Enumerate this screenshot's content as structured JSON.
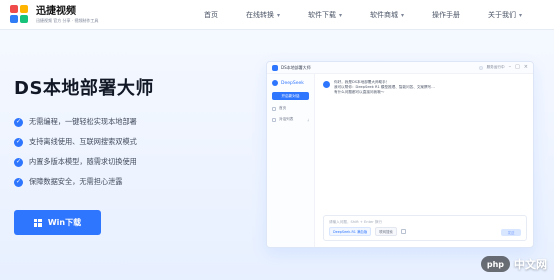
{
  "brand": {
    "title": "迅捷视频",
    "subtitle": "迅捷视频 官方 分享 · 视频制作工具"
  },
  "nav": {
    "items": [
      {
        "label": "首页",
        "has_caret": false
      },
      {
        "label": "在线转换",
        "has_caret": true
      },
      {
        "label": "软件下载",
        "has_caret": true
      },
      {
        "label": "软件商城",
        "has_caret": true
      },
      {
        "label": "操作手册",
        "has_caret": false
      },
      {
        "label": "关于我们",
        "has_caret": true
      }
    ]
  },
  "hero": {
    "title": "DS本地部署大师",
    "features": [
      "无需编程，一键轻松实现本地部署",
      "支持离线使用、互联网搜索双模式",
      "内置多版本模型，随需求切换使用",
      "保障数据安全，无需担心泄露"
    ],
    "cta_label": "Win下载"
  },
  "app_mock": {
    "window_title": "DS本地部署大师",
    "top_right_label": "服务运行中",
    "side": {
      "brand": "DeepSeek",
      "new_chat": "开启新对话",
      "items": [
        {
          "label": "首页",
          "right": ""
        },
        {
          "label": "对话列表",
          "right": "⤓"
        }
      ]
    },
    "chat": {
      "message_lines": [
        "你好，我是DS本地部署大师助手！",
        "我可以帮你：DeepSeek R1 模型推理、智能问答、文案撰写…",
        "有什么问题都可以直接问我哦～"
      ],
      "composer_placeholder": "请输入问题，Shift + Enter 换行",
      "tags": [
        "DeepSeek-R1 满血版",
        "联网搜索"
      ],
      "send_label": "发送"
    }
  },
  "watermark": {
    "badge": "php",
    "text": "中文网"
  },
  "colors": {
    "accent": "#2f76ff"
  }
}
